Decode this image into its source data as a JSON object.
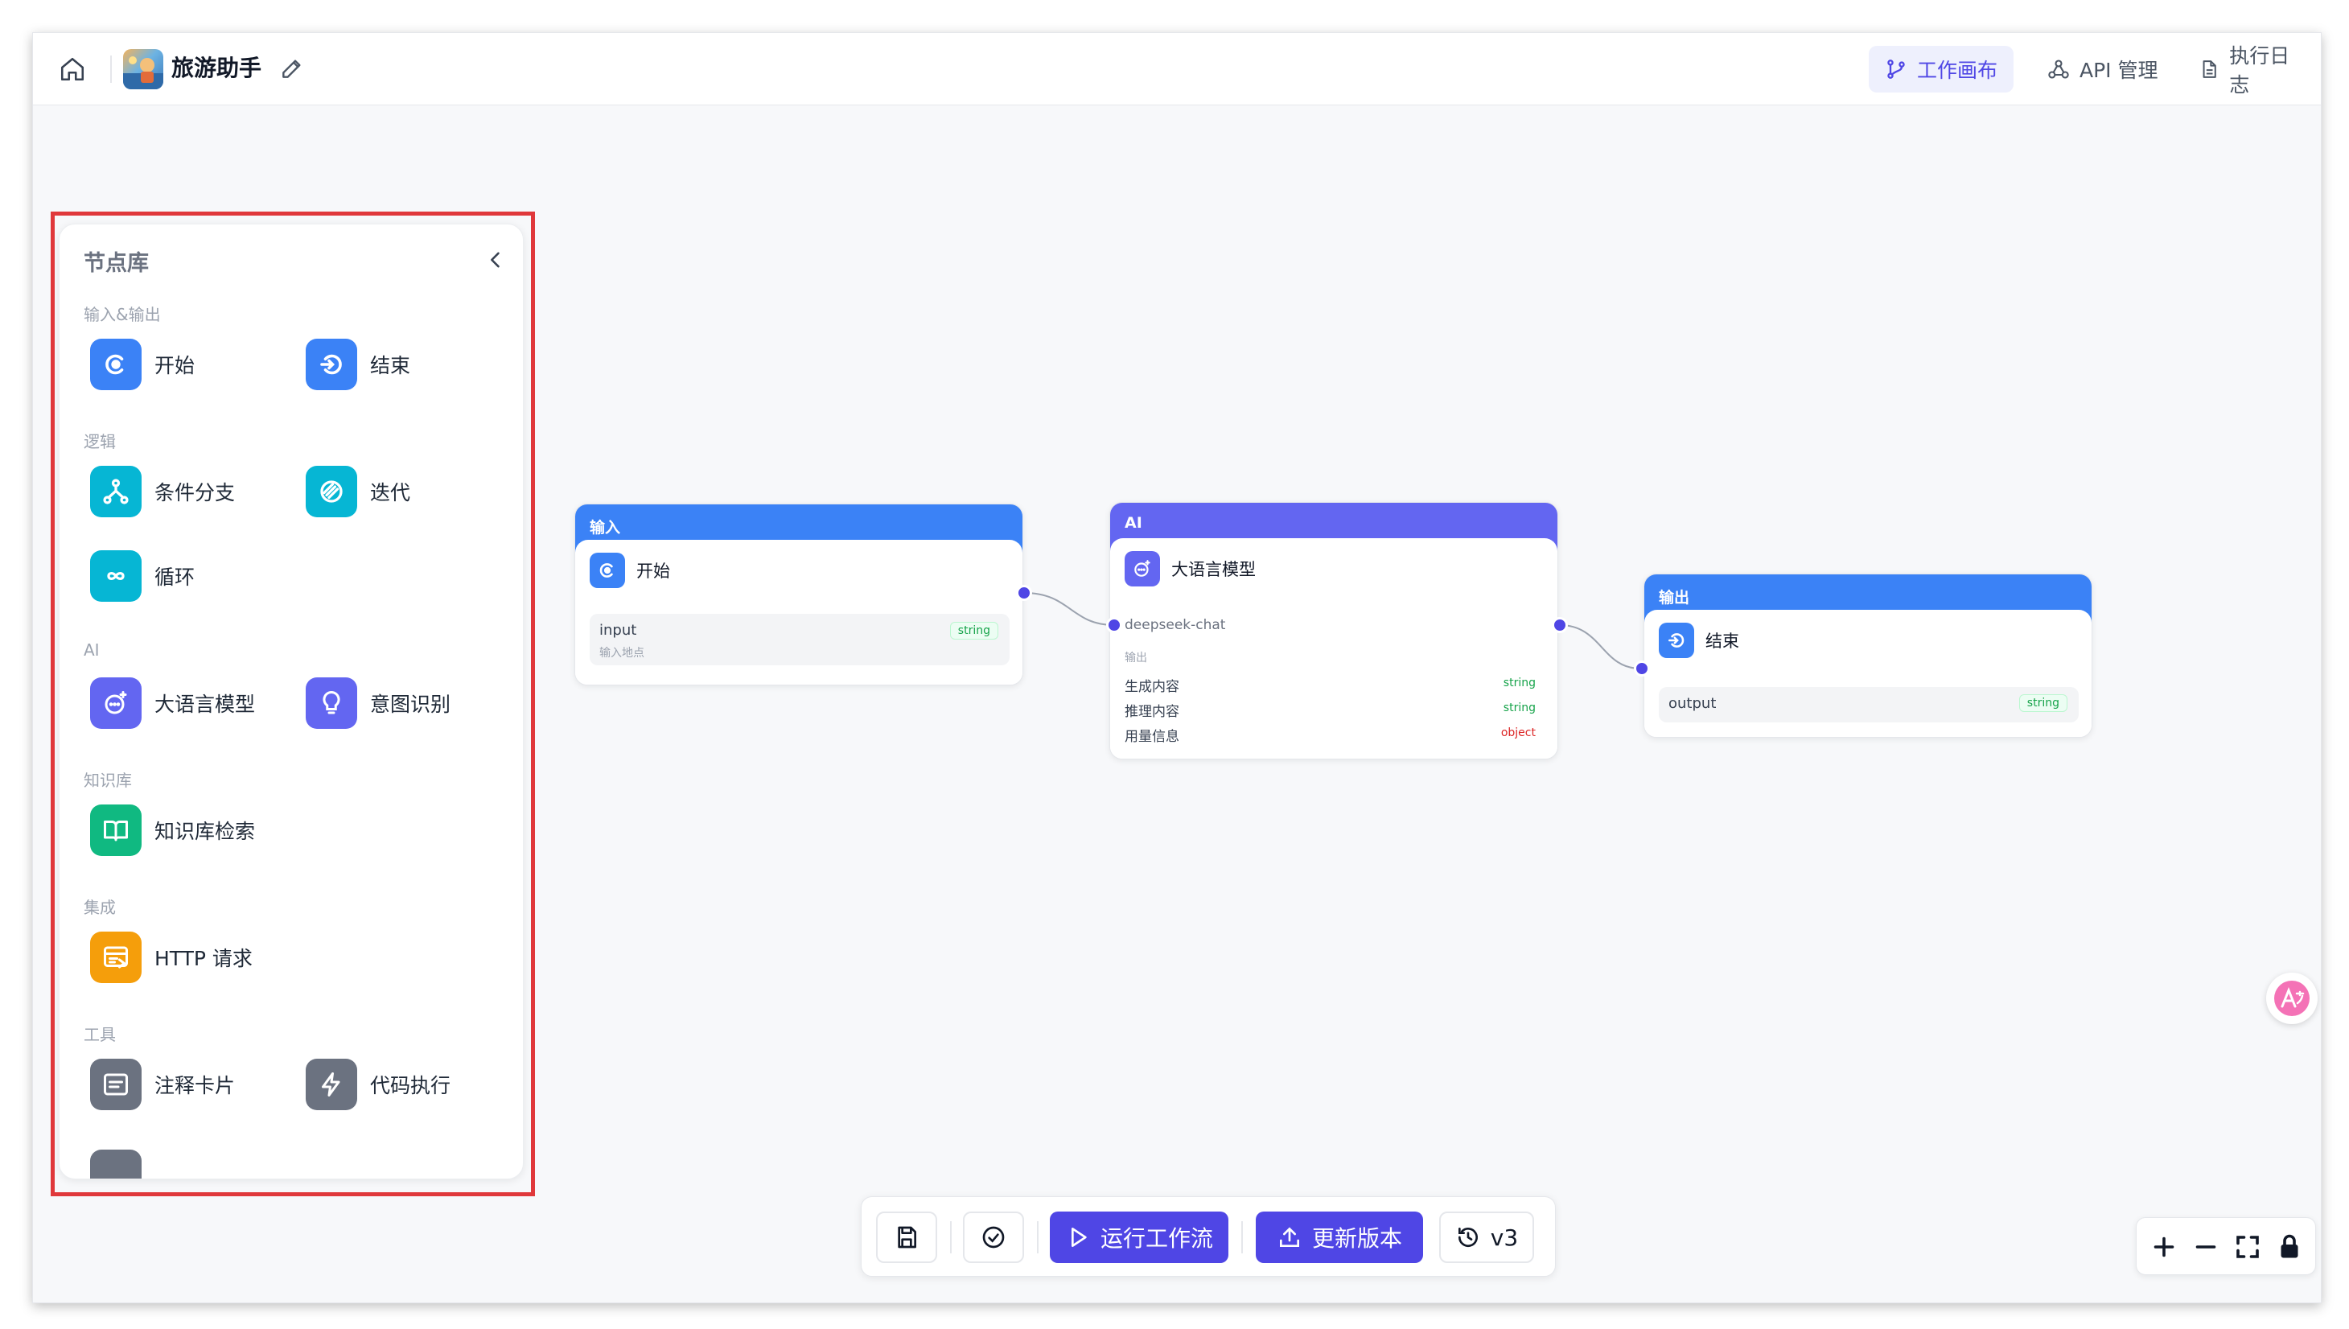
{
  "header": {
    "title": "旅游助手",
    "tabs": [
      {
        "label": "工作画布",
        "active": true
      },
      {
        "label": "API 管理",
        "active": false
      },
      {
        "label": "执行日志",
        "active": false
      }
    ]
  },
  "panel": {
    "title": "节点库",
    "categories": [
      {
        "label": "输入&输出",
        "items": [
          "开始",
          "结束"
        ]
      },
      {
        "label": "逻辑",
        "items": [
          "条件分支",
          "迭代",
          "循环"
        ]
      },
      {
        "label": "AI",
        "items": [
          "大语言模型",
          "意图识别"
        ]
      },
      {
        "label": "知识库",
        "items": [
          "知识库检索"
        ]
      },
      {
        "label": "集成",
        "items": [
          "HTTP 请求"
        ]
      },
      {
        "label": "工具",
        "items": [
          "注释卡片",
          "代码执行"
        ]
      }
    ]
  },
  "canvas": {
    "start_node": {
      "header": "输入",
      "title": "开始",
      "field_name": "input",
      "field_desc": "输入地点",
      "field_type": "string"
    },
    "llm_node": {
      "header": "AI",
      "title": "大语言模型",
      "model": "deepseek-chat",
      "output_label": "输出",
      "outputs": [
        {
          "name": "生成内容",
          "type": "string"
        },
        {
          "name": "推理内容",
          "type": "string"
        },
        {
          "name": "用量信息",
          "type": "object"
        }
      ]
    },
    "end_node": {
      "header": "输出",
      "title": "结束",
      "field_name": "output",
      "field_type": "string"
    }
  },
  "toolbar": {
    "run_label": "运行工作流",
    "update_label": "更新版本",
    "version_label": "v3"
  },
  "colors": {
    "accent": "#4f46e5",
    "input_header": "#3b82f6",
    "ai_header": "#6366f1"
  }
}
